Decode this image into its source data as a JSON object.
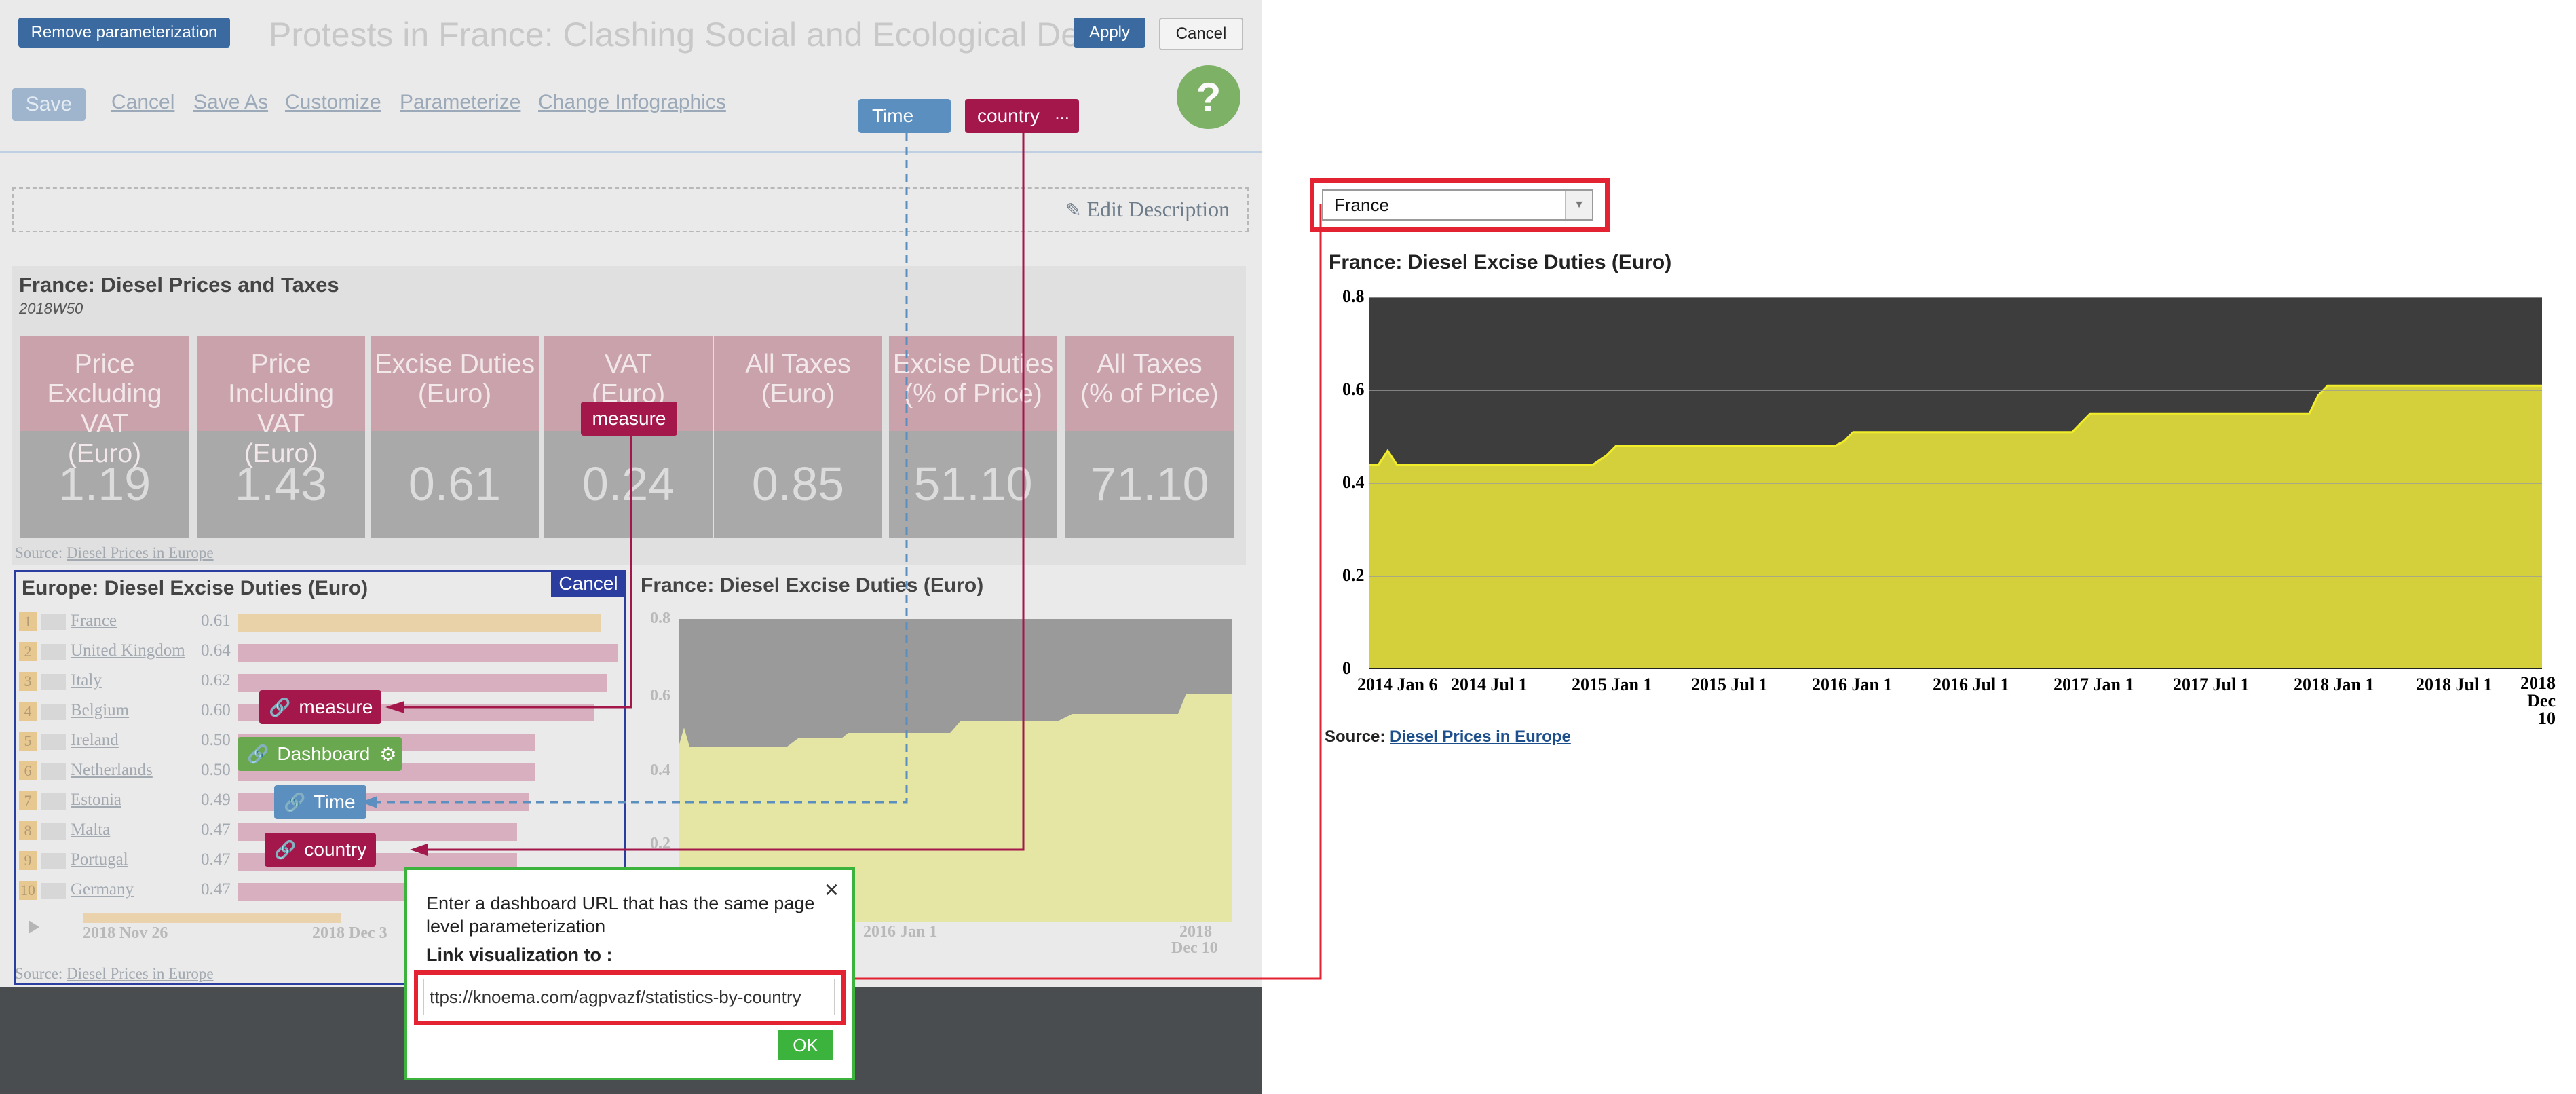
{
  "toolbar": {
    "remove_param_label": "Remove parameterization",
    "page_title": "Protests in France: Clashing Social and Ecological Demands",
    "apply_label": "Apply",
    "cancel_label": "Cancel",
    "help_glyph": "?",
    "links": [
      "Save",
      "Cancel",
      "Save As",
      "Customize",
      "Parameterize",
      "Change Infographics"
    ],
    "param_time": "Time",
    "param_country": "country",
    "param_more": "...",
    "edit_description": "Edit Description"
  },
  "prices_section": {
    "title": "France: Diesel Prices and Taxes",
    "period": "2018W50",
    "tiles": [
      {
        "label": "Price Excluding\nVAT\n(Euro)",
        "value": "1.19"
      },
      {
        "label": "Price Including\nVAT\n(Euro)",
        "value": "1.43"
      },
      {
        "label": "Excise Duties\n(Euro)",
        "value": "0.61"
      },
      {
        "label": "VAT\n(Euro)",
        "value": "0.24"
      },
      {
        "label": "All Taxes\n(Euro)",
        "value": "0.85"
      },
      {
        "label": "Excise Duties\n(% of Price)",
        "value": "51.10"
      },
      {
        "label": "All Taxes\n(% of Price)",
        "value": "71.10"
      }
    ],
    "measure_tag": "measure",
    "source_label": "Source:",
    "source_link": "Diesel Prices in Europe"
  },
  "europe_panel": {
    "title": "Europe: Diesel Excise Duties (Euro)",
    "cancel_label": "Cancel",
    "rows": [
      {
        "rank": "1",
        "country": "France",
        "value": "0.61",
        "bar": 0.61
      },
      {
        "rank": "2",
        "country": "United Kingdom",
        "value": "0.64",
        "bar": 0.64
      },
      {
        "rank": "3",
        "country": "Italy",
        "value": "0.62",
        "bar": 0.62
      },
      {
        "rank": "4",
        "country": "Belgium",
        "value": "0.60",
        "bar": 0.6
      },
      {
        "rank": "5",
        "country": "Ireland",
        "value": "0.50",
        "bar": 0.5
      },
      {
        "rank": "6",
        "country": "Netherlands",
        "value": "0.50",
        "bar": 0.5
      },
      {
        "rank": "7",
        "country": "Estonia",
        "value": "0.49",
        "bar": 0.49
      },
      {
        "rank": "8",
        "country": "Malta",
        "value": "0.47",
        "bar": 0.47
      },
      {
        "rank": "9",
        "country": "Portugal",
        "value": "0.47",
        "bar": 0.47
      },
      {
        "rank": "10",
        "country": "Germany",
        "value": "0.47",
        "bar": 0.47
      }
    ],
    "timeline_start": "2018 Nov 26",
    "timeline_end": "2018 Dec 3",
    "source_label": "Source:",
    "source_link": "Diesel Prices in Europe"
  },
  "link_tags": {
    "measure": "measure",
    "dashboard": "Dashboard",
    "time": "Time",
    "country": "country"
  },
  "france_small": {
    "title": "France: Diesel Excise Duties (Euro)",
    "yticks": [
      "0.8",
      "0.6",
      "0.4",
      "0.2"
    ],
    "xticks": [
      "2016 Jan 1",
      "2018",
      "Dec 10"
    ]
  },
  "link_dialog": {
    "instructions": "Enter a dashboard URL that has the same page level parameterization",
    "link_label": "Link visualization to :",
    "url_value": "ttps://knoema.com/agpvazf/statistics-by-country",
    "ok_label": "OK",
    "close_glyph": "×"
  },
  "right_panel": {
    "country_select": "France",
    "chart_title": "France: Diesel Excise Duties (Euro)",
    "source_label": "Source:",
    "source_link": "Diesel Prices in Europe"
  },
  "colors": {
    "area_fill": "#d4d03c",
    "area_line": "#f1ed2a",
    "plot_bg": "#3d3d3d",
    "tag_crimson": "#a3174b",
    "tag_blue": "#5b8fc0",
    "tag_green": "#6aa84f",
    "highlight_red": "#e32232",
    "dialog_green": "#3cb33c"
  },
  "chart_data": {
    "type": "area",
    "title": "France: Diesel Excise Duties (Euro)",
    "xlabel": "",
    "ylabel": "",
    "x_tick_labels": [
      "2014 Jan 6",
      "2014 Jul 1",
      "2015 Jan 1",
      "2015 Jul 1",
      "2016 Jan 1",
      "2016 Jul 1",
      "2017 Jan 1",
      "2017 Jul 1",
      "2018 Jan 1",
      "2018 Jul 1",
      "2018 Dec 10"
    ],
    "y_tick_labels": [
      "0",
      "0.2",
      "0.4",
      "0.6",
      "0.8"
    ],
    "ylim": [
      0,
      0.8
    ],
    "xlim": [
      "2014-01-06",
      "2018-12-10"
    ],
    "grid": true,
    "series": [
      {
        "x": [
          "2014-01-06",
          "2014-01-20",
          "2014-02-03",
          "2014-02-17",
          "2014-03-03",
          "2014-12-15",
          "2015-01-05",
          "2015-01-19",
          "2015-12-21",
          "2016-01-04",
          "2016-01-18",
          "2016-12-19",
          "2017-01-02",
          "2017-01-16",
          "2017-12-18",
          "2018-01-01",
          "2018-01-15",
          "2018-12-10"
        ],
        "y": [
          0.44,
          0.44,
          0.47,
          0.44,
          0.44,
          0.44,
          0.46,
          0.48,
          0.48,
          0.49,
          0.51,
          0.51,
          0.53,
          0.55,
          0.55,
          0.59,
          0.61,
          0.61
        ]
      }
    ]
  }
}
